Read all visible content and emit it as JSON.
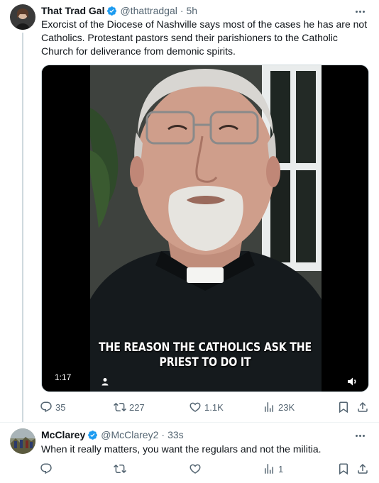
{
  "tweets": [
    {
      "display_name": "That Trad Gal",
      "handle": "@thattradgal",
      "separator": "·",
      "time": "5h",
      "text": "Exorcist of the Diocese of Nashville says most of the cases he has are not Catholics. Protestant pastors send their parishioners to the Catholic Church for deliverance from demonic spirits.",
      "media": {
        "caption_line1": "THE REASON THE CATHOLICS ASK THE",
        "caption_line2": "PRIEST TO DO IT",
        "duration": "1:17"
      },
      "stats": {
        "replies": "35",
        "retweets": "227",
        "likes": "1.1K",
        "views": "23K"
      }
    },
    {
      "display_name": "McClarey",
      "handle": "@McClarey2",
      "separator": "·",
      "time": "33s",
      "text": "When it really matters, you want the regulars and not the militia.",
      "stats": {
        "replies": "",
        "retweets": "",
        "likes": "",
        "views": "1"
      }
    }
  ],
  "colors": {
    "verified": "#1d9bf0",
    "secondary_text": "#536471",
    "primary_text": "#0f1419"
  },
  "icons": [
    "verified-badge-icon",
    "more-icon",
    "reply-icon",
    "retweet-icon",
    "like-icon",
    "views-icon",
    "bookmark-icon",
    "share-icon",
    "person-tag-icon",
    "volume-icon"
  ]
}
